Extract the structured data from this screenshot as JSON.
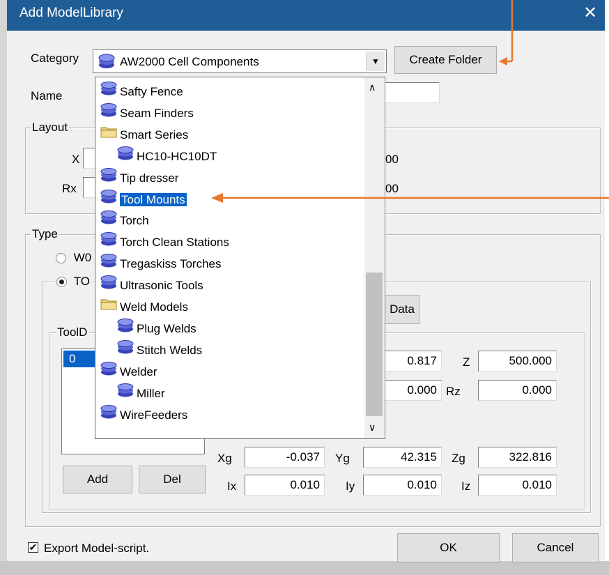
{
  "window": {
    "title": "Add ModelLibrary",
    "close_glyph": "✕"
  },
  "category": {
    "label": "Category",
    "selected": "AW2000 Cell Components",
    "dropdown_arrow": "▼"
  },
  "create_folder_label": "Create Folder",
  "name_label": "Name",
  "layout": {
    "label": "Layout",
    "x_label": "X",
    "rx_label": "Rx",
    "x_tail": "00",
    "rx_tail": "00"
  },
  "type": {
    "label": "Type",
    "option1_label": "W0",
    "option2_label": "TO",
    "data_button_tail": "Data"
  },
  "tool": {
    "group_label": "ToolD",
    "list_items": [
      "0"
    ],
    "fields": {
      "y_value": "0.817",
      "z_label": "Z",
      "z_value": "500.000",
      "ry_value": "0.000",
      "rz_label": "Rz",
      "rz_value": "0.000",
      "xg_label": "Xg",
      "xg_value": "-0.037",
      "yg_label": "Yg",
      "yg_value": "42.315",
      "zg_label": "Zg",
      "zg_value": "322.816",
      "ix_label": "Ix",
      "ix_value": "0.010",
      "iy_label": "Iy",
      "iy_value": "0.010",
      "iz_label": "Iz",
      "iz_value": "0.010"
    },
    "add_label": "Add",
    "del_label": "Del"
  },
  "dropdown_items": [
    {
      "label": "Safty Fence",
      "icon": "stack-icon"
    },
    {
      "label": "Seam Finders",
      "icon": "stack-icon"
    },
    {
      "label": "Smart Series",
      "icon": "folder-icon"
    },
    {
      "label": "HC10-HC10DT",
      "icon": "stack-icon"
    },
    {
      "label": "Tip dresser",
      "icon": "stack-icon"
    },
    {
      "label": "Tool Mounts",
      "icon": "stack-icon"
    },
    {
      "label": "Torch",
      "icon": "stack-icon"
    },
    {
      "label": "Torch Clean Stations",
      "icon": "stack-icon"
    },
    {
      "label": "Tregaskiss Torches",
      "icon": "stack-icon"
    },
    {
      "label": "Ultrasonic Tools",
      "icon": "stack-icon"
    },
    {
      "label": "Weld Models",
      "icon": "folder-icon"
    },
    {
      "label": "Plug Welds",
      "icon": "stack-icon"
    },
    {
      "label": "Stitch Welds",
      "icon": "stack-icon"
    },
    {
      "label": "Welder",
      "icon": "stack-icon"
    },
    {
      "label": "Miller",
      "icon": "stack-icon"
    },
    {
      "label": "WireFeeders",
      "icon": "stack-icon"
    }
  ],
  "selected_item": "Tool Mounts",
  "scroll": {
    "up_glyph": "∧",
    "down_glyph": "∨"
  },
  "footer": {
    "export_label": "Export Model-script.",
    "export_checked_glyph": "✔",
    "ok_label": "OK",
    "cancel_label": "Cancel"
  },
  "colors": {
    "annotation_arrow": "#e8782b",
    "titlebar": "#1f5d96",
    "selection": "#0a62c8"
  }
}
